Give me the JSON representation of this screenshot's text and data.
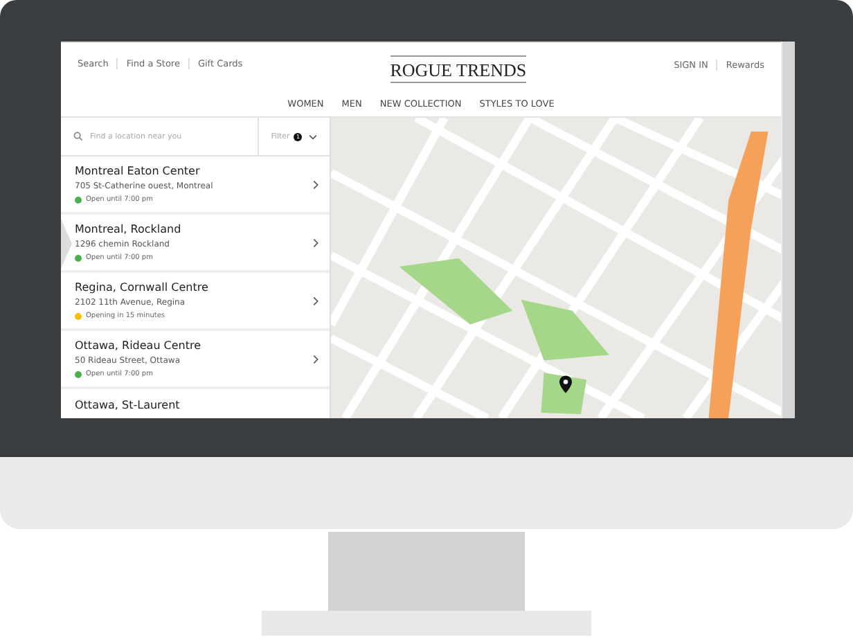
{
  "header": {
    "utility_links": [
      "Search",
      "Find a Store",
      "Gift Cards"
    ],
    "logo": "ROGUE TRENDS",
    "account_links": [
      "SIGN IN",
      "Rewards"
    ]
  },
  "nav": [
    "WOMEN",
    "MEN",
    "NEW COLLECTION",
    "STYLES TO LOVE"
  ],
  "search": {
    "placeholder": "Find a location near you"
  },
  "filter": {
    "label": "Filter",
    "count": "1"
  },
  "stores": [
    {
      "name": "Montreal Eaton Center",
      "address": "705 St-Catherine ouest, Montreal",
      "status": "Open until 7:00 pm",
      "color": "#4caf50",
      "selected": false
    },
    {
      "name": "Montreal, Rockland",
      "address": "1296 chemin Rockland",
      "status": "Open until 7:00 pm",
      "color": "#4caf50",
      "selected": true
    },
    {
      "name": "Regina, Cornwall Centre",
      "address": "2102 11th Avenue, Regina",
      "status": "Opening in 15 minutes",
      "color": "#f5c000",
      "selected": false
    },
    {
      "name": "Ottawa,  Rideau Centre",
      "address": "50 Rideau Street, Ottawa",
      "status": "Open until 7:00 pm",
      "color": "#4caf50",
      "selected": false
    },
    {
      "name": "Ottawa, St-Laurent",
      "selected": false
    }
  ]
}
